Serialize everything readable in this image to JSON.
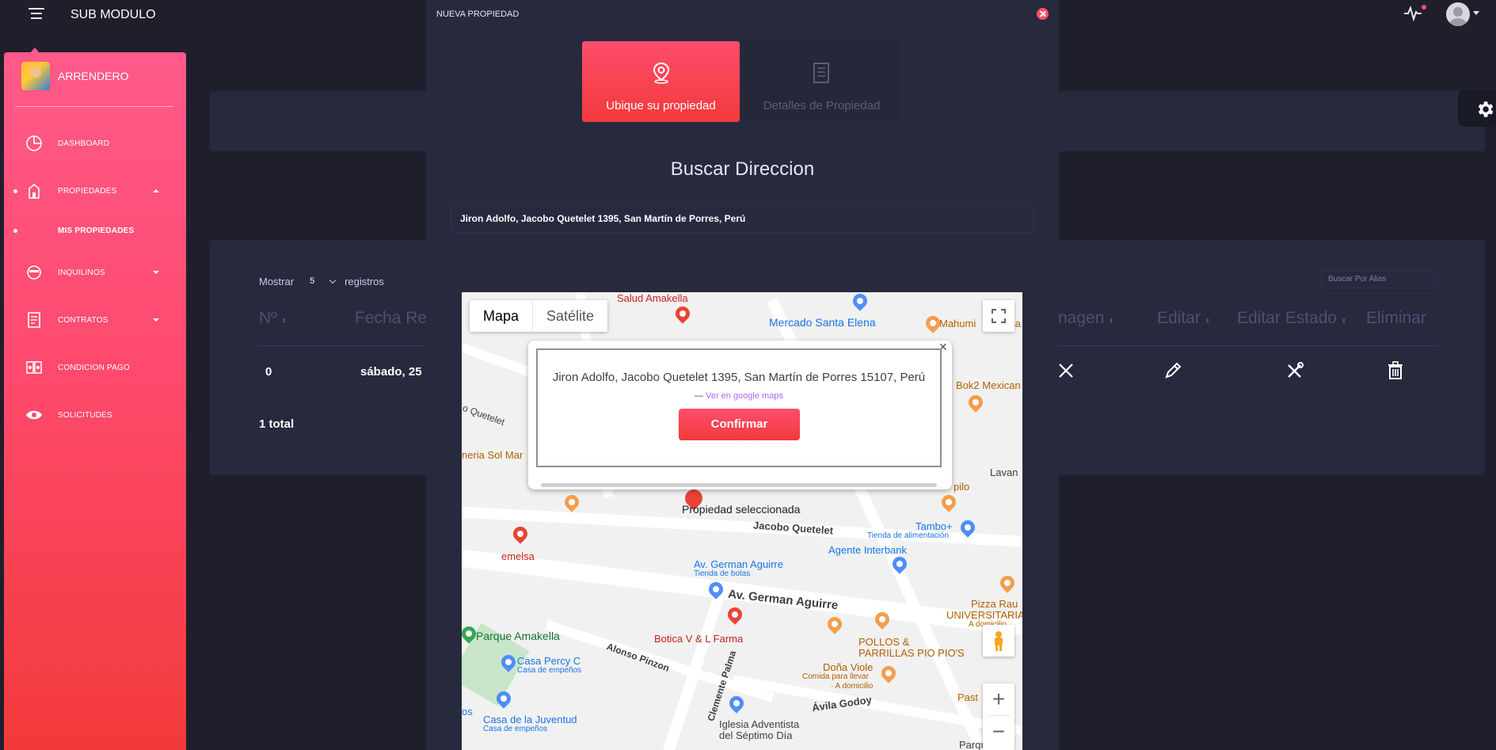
{
  "topbar": {
    "title": "SUB MODULO"
  },
  "sidebar": {
    "profile_name": "ARRENDERO",
    "items": [
      {
        "label": "DASHBOARD"
      },
      {
        "label": "PROPIEDADES"
      },
      {
        "label": "MIS PROPIEDADES"
      },
      {
        "label": "INQUILINOS"
      },
      {
        "label": "CONTRATOS"
      },
      {
        "label": "CONDICION PAGO"
      },
      {
        "label": "SOLICITUDES"
      }
    ]
  },
  "table": {
    "show_label": "Mostrar",
    "page_size": "5",
    "records_label": "registros",
    "search_placeholder": "Buscar Por Alias",
    "columns": [
      "Nº",
      "Fecha Re",
      "nagen",
      "Editar",
      "Editar Estado",
      "Eliminar"
    ],
    "row": {
      "num": "0",
      "fecha": "sábado, 25"
    },
    "total": "1 total"
  },
  "modal": {
    "title": "NUEVA PROPIEDAD",
    "steps": [
      {
        "label": "Ubique su propiedad"
      },
      {
        "label": "Detalles de Propiedad"
      }
    ],
    "heading": "Buscar Direccion",
    "address_value": "Jiron Adolfo, Jacobo Quetelet 1395, San Martín de Porres, Perú"
  },
  "map": {
    "type_map": "Mapa",
    "type_satellite": "Satélite",
    "info_address": "Jiron Adolfo, Jacobo Quetelet 1395, San Martín de Porres 15107, Perú",
    "info_link_prefix": "— ",
    "info_link": "Ver en google maps",
    "confirm": "Confirmar",
    "selected_label": "Propiedad seleccionada",
    "labels": {
      "salud": "Salud Amakella",
      "mercado": "Mercado Santa Elena",
      "mahumi": "Mahumi",
      "ba": "Ba",
      "quetelet_left": "o Quetelet",
      "bok2": "Bok2 Mexican",
      "neria": "neria Sol Mar",
      "lavan": "Lavan",
      "pilo": "pilo",
      "jacobo": "Jacobo Quetelet",
      "tambo": "Tambo+",
      "tienda_alim": "Tienda de alimentación",
      "agente": "Agente Interbank",
      "emelsa": "emelsa",
      "german_small": "Av. German Aguirre",
      "tienda_botas": "Tienda de botas",
      "german_big": "Av. German Aguirre",
      "pizza": "Pizza Rau",
      "universitaria": "UNIVERSITARIA",
      "domicilio": "A domicilio",
      "parque_amakella": "Parque Amakella",
      "botica": "Botica V & L Farma",
      "pollos1": "POLLOS &",
      "pollos2": "PARRILLAS PIO PIO'S",
      "alonso": "Alonso Pinzon",
      "casa_percy": "Casa Percy C",
      "casa_empenos1": "Casa de empeños",
      "dona_viole": "Doña Viole",
      "comida": "Comida para llevar",
      "domicilio2": "· A domicilio",
      "clemente": "Clemente Palma",
      "casa_juventud": "Casa de la Juventud",
      "casa_empenos2": "Casa de empeños",
      "os": "os",
      "iglesia1": "Iglesia Adventista",
      "iglesia2": "del Séptimo Día",
      "avila": "Ávila Godoy",
      "past": "Past",
      "parque_jos": "Parque Jos"
    }
  }
}
